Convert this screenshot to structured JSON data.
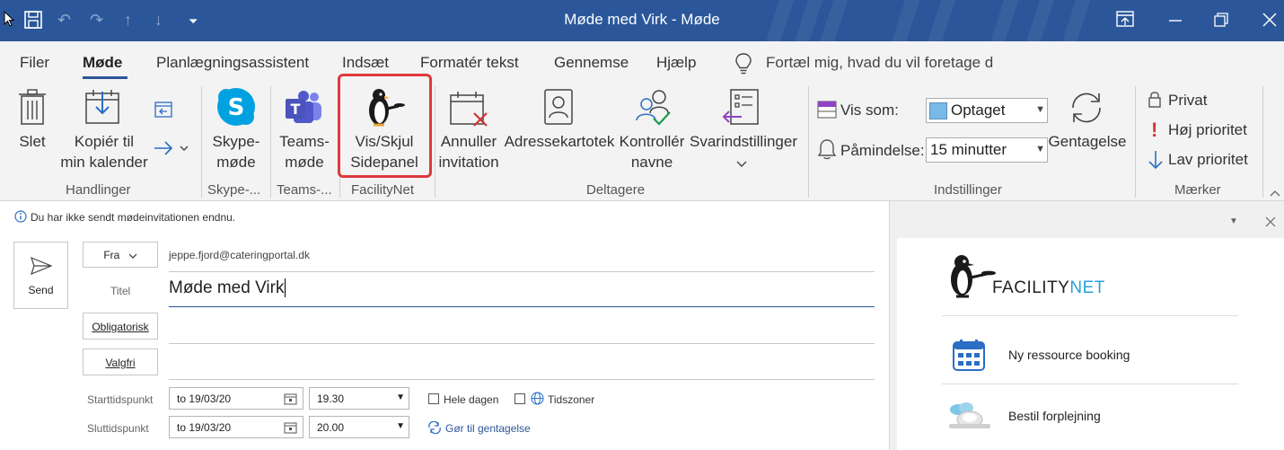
{
  "window": {
    "title": "Møde med Virk  -  Møde"
  },
  "menu_tabs": [
    {
      "label": "Filer"
    },
    {
      "label": "Møde"
    },
    {
      "label": "Planlægningsassistent"
    },
    {
      "label": "Indsæt"
    },
    {
      "label": "Formatér tekst"
    },
    {
      "label": "Gennemse"
    },
    {
      "label": "Hjælp"
    }
  ],
  "tell_me": {
    "text": "Fortæl mig, hvad du vil foretage d"
  },
  "ribbon": {
    "handlinger": {
      "delete": "Slet",
      "copy_line1": "Kopiér til",
      "copy_line2": "min kalender",
      "group": "Handlinger"
    },
    "skype": {
      "line1": "Skype-",
      "line2": "møde",
      "group": "Skype-..."
    },
    "teams": {
      "line1": "Teams-",
      "line2": "møde",
      "group": "Teams-..."
    },
    "facilitynet": {
      "line1": "Vis/Skjul",
      "line2": "Sidepanel",
      "group": "FacilityNet"
    },
    "deltagere": {
      "cancel_line1": "Annuller",
      "cancel_line2": "invitation",
      "address": "Adressekartotek",
      "check_line1": "Kontrollér",
      "check_line2": "navne",
      "response": "Svarindstillinger",
      "group": "Deltagere"
    },
    "indstillinger": {
      "show_as_label": "Vis som:",
      "show_as_value": "Optaget",
      "reminder_label": "Påmindelse:",
      "reminder_value": "15 minutter",
      "recurrence": "Gentagelse",
      "group": "Indstillinger"
    },
    "maerker": {
      "private": "Privat",
      "high": "Høj prioritet",
      "low": "Lav prioritet",
      "group": "Mærker"
    }
  },
  "form": {
    "info": "Du har ikke sendt mødeinvitationen endnu.",
    "send": "Send",
    "from_button": "Fra",
    "from_value": "jeppe.fjord@cateringportal.dk",
    "title_label": "Titel",
    "title_value": "Møde med Virk",
    "required_button": "Obligatorisk",
    "optional_button": "Valgfri",
    "start_label": "Starttidspunkt",
    "start_date": "to 19/03/20",
    "start_time": "19.30",
    "all_day": "Hele dagen",
    "timezones": "Tidszoner",
    "end_label": "Sluttidspunkt",
    "end_date": "to 19/03/20",
    "end_time": "20.00",
    "make_recurring": "Gør til gentagelse"
  },
  "side_panel": {
    "brand_left": "FACILITY",
    "brand_right": "NET",
    "booking": "Ny ressource booking",
    "catering": "Bestil forplejning"
  },
  "colors": {
    "titlebar": "#2b579a",
    "highlight": "#e0393e",
    "show_as_swatch": "#79b9e8",
    "priority_high": "#d13438",
    "priority_low": "#2b6ec4",
    "brand_net": "#2aa1d8"
  }
}
